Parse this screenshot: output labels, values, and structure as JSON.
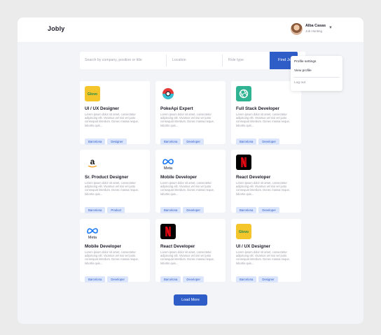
{
  "header": {
    "brand": "Jobly",
    "user_name": "Alba Casas",
    "user_role": "Job Hunting"
  },
  "dropdown": {
    "items": [
      "Profile settings",
      "View profile",
      "Log out"
    ]
  },
  "search": {
    "company_placeholder": "Search by company, position or title",
    "location_placeholder": "Location",
    "role_placeholder": "Role type",
    "button_label": "Find Jobs"
  },
  "description": "Lorem ipsum dolor sit amet, consectetur adipiscing elit. Vivamus vel nisi vel justo consequat interdum. Donec massa neque, lobortis quis...",
  "cards": [
    {
      "title": "UI / UX Designer",
      "logo": "glovo-logo",
      "tags": [
        "Barcelona",
        "Designer"
      ]
    },
    {
      "title": "PokeApi Expert",
      "logo": "pokeball-logo",
      "tags": [
        "Barcelona",
        "Developer"
      ]
    },
    {
      "title": "Full Stack Developer",
      "logo": "openai-logo",
      "tags": [
        "Barcelona",
        "Developer"
      ]
    },
    {
      "title": "Sr. Product Designer",
      "logo": "amazon-logo",
      "tags": [
        "Barcelona",
        "Product"
      ]
    },
    {
      "title": "Mobile Developer",
      "logo": "meta-logo",
      "tags": [
        "Barcelona",
        "Developer"
      ]
    },
    {
      "title": "React Developer",
      "logo": "netflix-logo",
      "tags": [
        "Barcelona",
        "Developer"
      ]
    },
    {
      "title": "Mobile Developer",
      "logo": "meta-logo",
      "tags": [
        "Barcelona",
        "Developer"
      ]
    },
    {
      "title": "React Developer",
      "logo": "netflix-logo",
      "tags": [
        "Barcelona",
        "Developer"
      ]
    },
    {
      "title": "UI / UX Designer",
      "logo": "glovo-logo",
      "tags": [
        "Barcelona",
        "Designer"
      ]
    }
  ],
  "load_more_label": "Load More",
  "colors": {
    "accent": "#2f5dc8",
    "tag_bg": "#dbe5fb"
  }
}
